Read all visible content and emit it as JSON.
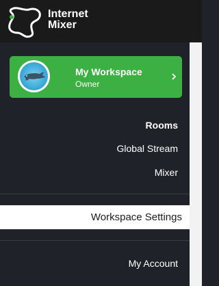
{
  "brand": {
    "line1": "Internet",
    "line2": "Mixer",
    "logo_icon": "blob-logo-icon"
  },
  "workspace": {
    "name": "My Workspace",
    "role": "Owner",
    "avatar": "dolphin-avatar",
    "card_color": "#3cb043"
  },
  "nav": {
    "rooms": "Rooms",
    "global_stream": "Global Stream",
    "mixer": "Mixer",
    "workspace_settings": "Workspace Settings",
    "my_account": "My Account"
  }
}
